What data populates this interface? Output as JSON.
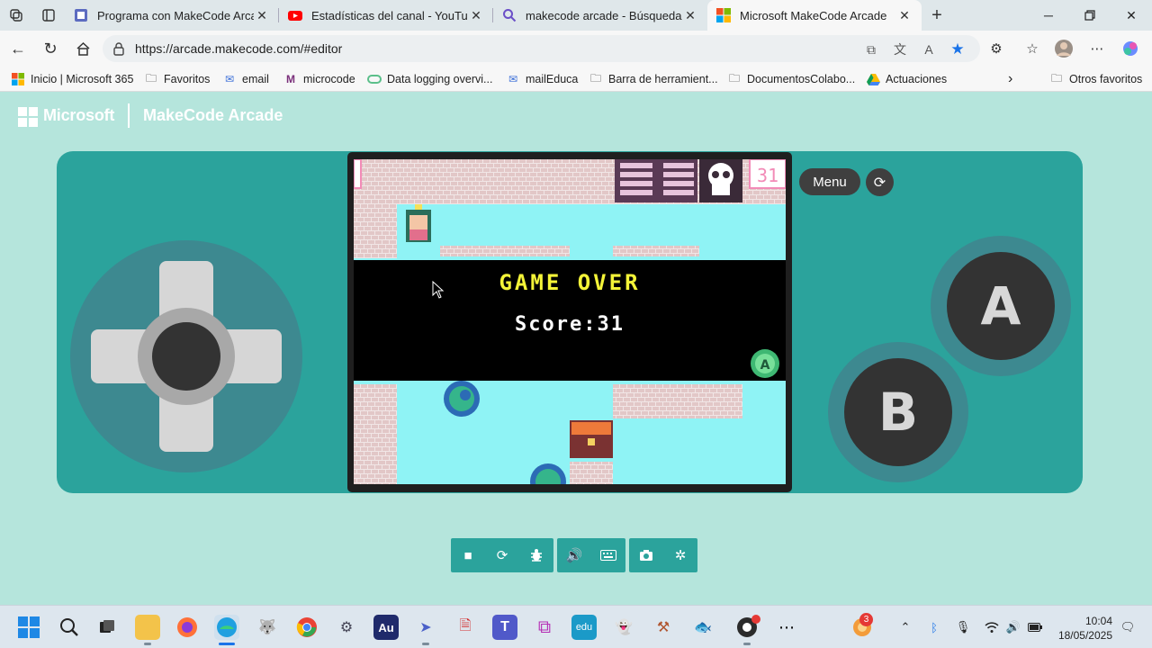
{
  "browser": {
    "tabs": [
      {
        "title": "Programa con MakeCode Arcade",
        "icon": "makecode-tab-icon",
        "active": false
      },
      {
        "title": "Estadísticas del canal - YouTube Studio",
        "icon": "youtube-tab-icon",
        "active": false
      },
      {
        "title": "makecode arcade - Búsqueda",
        "icon": "search-tab-icon",
        "active": false
      },
      {
        "title": "Microsoft MakeCode Arcade",
        "icon": "microsoft-tab-icon",
        "active": true
      }
    ],
    "url": "https://arcade.makecode.com/#editor",
    "bookmarks": [
      {
        "label": "Inicio | Microsoft 365",
        "icon": "microsoft-icon"
      },
      {
        "label": "Favoritos",
        "icon": "folder-icon"
      },
      {
        "label": "email",
        "icon": "mail-icon"
      },
      {
        "label": "microcode",
        "icon": "microcode-icon"
      },
      {
        "label": "Data logging overvi...",
        "icon": "data-icon"
      },
      {
        "label": "mailEduca",
        "icon": "mail-icon"
      },
      {
        "label": "Barra de herramient...",
        "icon": "folder-icon"
      },
      {
        "label": "DocumentosColabo...",
        "icon": "folder-icon"
      },
      {
        "label": "Actuaciones",
        "icon": "drive-icon"
      }
    ],
    "other_favorites": "Otros favoritos"
  },
  "makecode": {
    "brand": "Microsoft",
    "title": "MakeCode Arcade",
    "menu_label": "Menu",
    "button_a": "A",
    "button_b": "B",
    "game": {
      "score_badge": "31",
      "banner_title": "GAME OVER",
      "banner_score": "Score:31"
    },
    "toolbar_icons": [
      "stop-icon",
      "restart-icon",
      "debug-icon",
      "sound-icon",
      "keyboard-icon",
      "screenshot-icon",
      "fullscreen-icon"
    ]
  },
  "taskbar": {
    "notification_count": "3",
    "time": "10:04",
    "date": "18/05/2025"
  },
  "colors": {
    "page_bg": "#b5e5dc",
    "sim_bg": "#2ba39c",
    "game_water": "#8ff3f5",
    "banner_text": "#f4f438"
  }
}
